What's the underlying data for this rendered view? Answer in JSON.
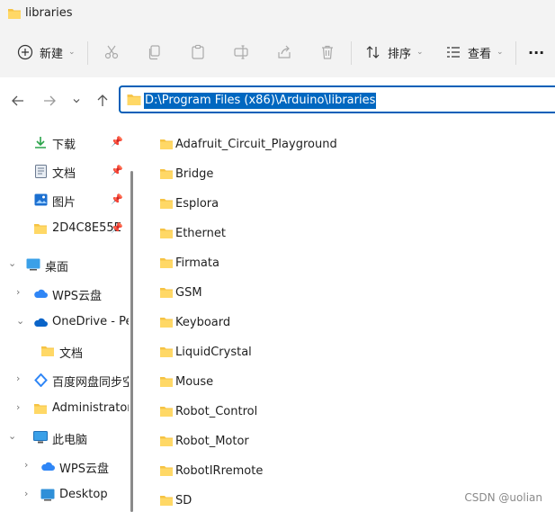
{
  "window": {
    "title": "libraries"
  },
  "toolbar": {
    "new_label": "新建",
    "sort_label": "排序",
    "view_label": "查看",
    "more_label": "···"
  },
  "address": {
    "path": "D:\\Program Files (x86)\\Arduino\\libraries"
  },
  "sidebar": {
    "items": [
      {
        "label": "下载"
      },
      {
        "label": "文档"
      },
      {
        "label": "图片"
      },
      {
        "label": "2D4C8E55E"
      },
      {
        "label": "桌面"
      },
      {
        "label": "WPS云盘"
      },
      {
        "label": "OneDrive - Pe"
      },
      {
        "label": "文档"
      },
      {
        "label": "百度网盘同步空"
      },
      {
        "label": "Administrator"
      },
      {
        "label": "此电脑"
      },
      {
        "label": "WPS云盘"
      },
      {
        "label": "Desktop"
      }
    ]
  },
  "files": [
    {
      "name": "Adafruit_Circuit_Playground"
    },
    {
      "name": "Bridge"
    },
    {
      "name": "Esplora"
    },
    {
      "name": "Ethernet"
    },
    {
      "name": "Firmata"
    },
    {
      "name": "GSM"
    },
    {
      "name": "Keyboard"
    },
    {
      "name": "LiquidCrystal"
    },
    {
      "name": "Mouse"
    },
    {
      "name": "Robot_Control"
    },
    {
      "name": "Robot_Motor"
    },
    {
      "name": "RobotIRremote"
    },
    {
      "name": "SD"
    }
  ],
  "watermark": "CSDN @uolian",
  "colors": {
    "accent": "#005fb8",
    "folder": "#f6c344",
    "selection": "#0067c0"
  }
}
